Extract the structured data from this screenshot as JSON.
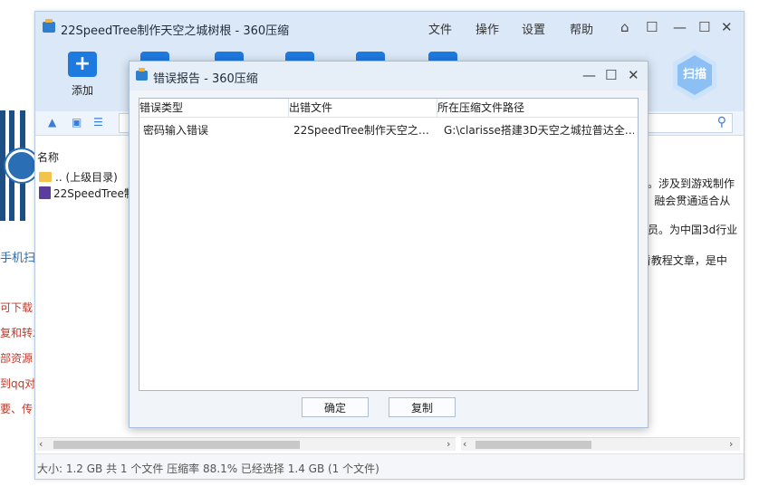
{
  "background_page": {
    "lines": [
      "手机扫",
      "可下载",
      "复和转发",
      "部资源",
      "到qq对",
      "要、传"
    ]
  },
  "window": {
    "title": "22SpeedTree制作天空之城树根 - 360压缩",
    "menus": [
      "文件",
      "操作",
      "设置",
      "帮助"
    ],
    "controls": [
      "⌂",
      "☐",
      "—",
      "☐",
      "✕"
    ]
  },
  "toolbar": {
    "add_label": "添加",
    "scan_label": "扫描"
  },
  "file_list": {
    "column_name": "名称",
    "rows": [
      {
        "name": ".. (上级目录)"
      },
      {
        "name": "22SpeedTree制"
      }
    ]
  },
  "description": {
    "lines": [
      "程。涉及到游戏制作",
      "a，融会贯通适合从",
      "会员。为中国3d行业",
      ",看教程文章，是中"
    ]
  },
  "status": {
    "text": "大小: 1.2 GB 共 1 个文件 压缩率 88.1% 已经选择 1.4 GB (1 个文件)"
  },
  "dialog": {
    "title": "错误报告 - 360压缩",
    "columns": [
      "错误类型",
      "出错文件",
      "所在压缩文件路径"
    ],
    "rows": [
      {
        "type": "密码输入错误",
        "file": "22SpeedTree制作天空之…",
        "path": "G:\\clarisse搭建3D天空之城拉普达全…"
      }
    ],
    "ok_label": "确定",
    "copy_label": "复制"
  },
  "colors": {
    "accent": "#1f7ae0",
    "titlebar": "#dbe8f7",
    "link_red": "#c0392b"
  }
}
